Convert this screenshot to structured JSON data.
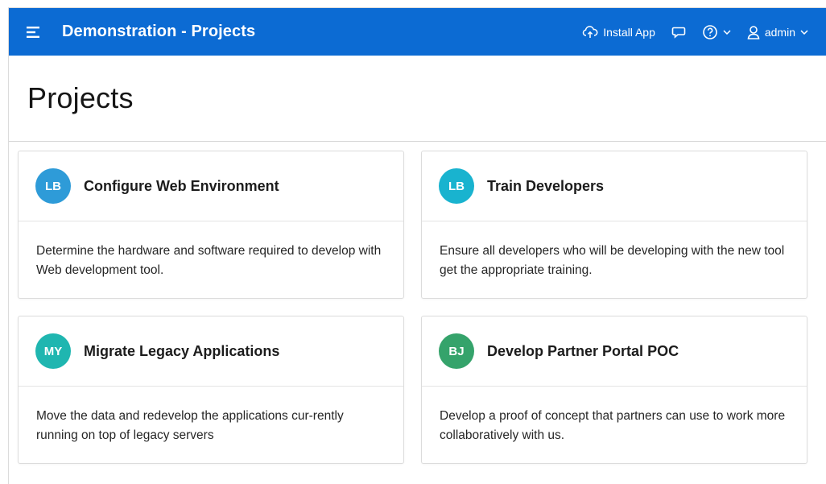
{
  "header": {
    "app_title": "Demonstration - Projects",
    "install_label": "Install App",
    "user_label": "admin",
    "bg_color": "#0c6bd3"
  },
  "page": {
    "title": "Projects"
  },
  "cards": [
    {
      "initials": "LB",
      "avatar_color": "#2e9bd8",
      "title": "Configure Web Environment",
      "body": "Determine the hardware and software required to develop with Web development tool."
    },
    {
      "initials": "LB",
      "avatar_color": "#19b3cf",
      "title": "Train Developers",
      "body": "Ensure all developers who will be developing with the new tool get the appropriate training."
    },
    {
      "initials": "MY",
      "avatar_color": "#1fb6b0",
      "title": "Migrate Legacy Applications",
      "body": "Move the data and redevelop the applications cur-rently running on top of legacy servers"
    },
    {
      "initials": "BJ",
      "avatar_color": "#35a36b",
      "title": "Develop Partner Portal POC",
      "body": "Develop a proof of concept that partners can use to work more collaboratively with us."
    }
  ],
  "icons": {
    "menu": "hamburger-menu-icon",
    "install": "cloud-upload-icon",
    "feedback": "chat-bubble-icon",
    "help": "help-circle-icon",
    "user": "user-icon",
    "chevron": "chevron-down-icon"
  }
}
